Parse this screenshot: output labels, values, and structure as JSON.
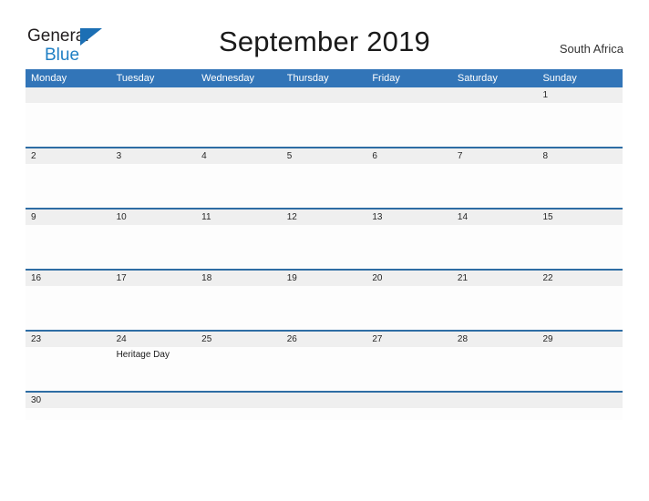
{
  "brand": {
    "name_part1": "General",
    "name_part2": "Blue",
    "flag_icon": "triangle-flag-icon",
    "color_dark": "#231f20",
    "color_blue": "#1f7fc4"
  },
  "header": {
    "title": "September 2019",
    "region": "South Africa",
    "accent_color": "#3275b8"
  },
  "calendar": {
    "weekdays": [
      "Monday",
      "Tuesday",
      "Wednesday",
      "Thursday",
      "Friday",
      "Saturday",
      "Sunday"
    ],
    "weeks": [
      {
        "days": [
          {
            "date": "",
            "event": ""
          },
          {
            "date": "",
            "event": ""
          },
          {
            "date": "",
            "event": ""
          },
          {
            "date": "",
            "event": ""
          },
          {
            "date": "",
            "event": ""
          },
          {
            "date": "",
            "event": ""
          },
          {
            "date": "1",
            "event": ""
          }
        ]
      },
      {
        "days": [
          {
            "date": "2",
            "event": ""
          },
          {
            "date": "3",
            "event": ""
          },
          {
            "date": "4",
            "event": ""
          },
          {
            "date": "5",
            "event": ""
          },
          {
            "date": "6",
            "event": ""
          },
          {
            "date": "7",
            "event": ""
          },
          {
            "date": "8",
            "event": ""
          }
        ]
      },
      {
        "days": [
          {
            "date": "9",
            "event": ""
          },
          {
            "date": "10",
            "event": ""
          },
          {
            "date": "11",
            "event": ""
          },
          {
            "date": "12",
            "event": ""
          },
          {
            "date": "13",
            "event": ""
          },
          {
            "date": "14",
            "event": ""
          },
          {
            "date": "15",
            "event": ""
          }
        ]
      },
      {
        "days": [
          {
            "date": "16",
            "event": ""
          },
          {
            "date": "17",
            "event": ""
          },
          {
            "date": "18",
            "event": ""
          },
          {
            "date": "19",
            "event": ""
          },
          {
            "date": "20",
            "event": ""
          },
          {
            "date": "21",
            "event": ""
          },
          {
            "date": "22",
            "event": ""
          }
        ]
      },
      {
        "days": [
          {
            "date": "23",
            "event": ""
          },
          {
            "date": "24",
            "event": "Heritage Day"
          },
          {
            "date": "25",
            "event": ""
          },
          {
            "date": "26",
            "event": ""
          },
          {
            "date": "27",
            "event": ""
          },
          {
            "date": "28",
            "event": ""
          },
          {
            "date": "29",
            "event": ""
          }
        ]
      },
      {
        "days": [
          {
            "date": "30",
            "event": ""
          },
          {
            "date": "",
            "event": ""
          },
          {
            "date": "",
            "event": ""
          },
          {
            "date": "",
            "event": ""
          },
          {
            "date": "",
            "event": ""
          },
          {
            "date": "",
            "event": ""
          },
          {
            "date": "",
            "event": ""
          }
        ]
      }
    ]
  }
}
